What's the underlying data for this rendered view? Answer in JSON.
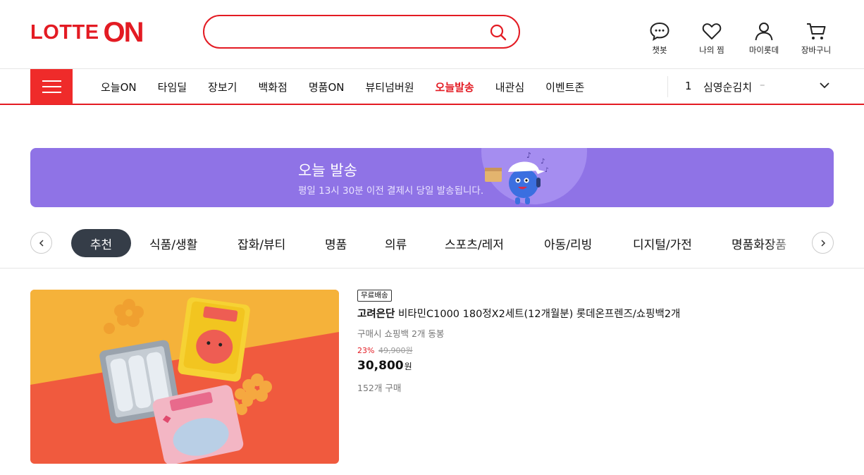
{
  "brand": {
    "logo_lotte": "LOTTE",
    "logo_on": "ON",
    "color": "#e31b23"
  },
  "search": {
    "placeholder": "",
    "value": ""
  },
  "utils": [
    {
      "label": "챗봇",
      "icon": "chat-icon"
    },
    {
      "label": "나의 찜",
      "icon": "heart-icon"
    },
    {
      "label": "마이롯데",
      "icon": "user-icon"
    },
    {
      "label": "장바구니",
      "icon": "cart-icon"
    }
  ],
  "nav": {
    "items": [
      "오늘ON",
      "타임딜",
      "장보기",
      "백화점",
      "명품ON",
      "뷰티넘버원",
      "오늘발송",
      "내관심",
      "이벤트존"
    ],
    "active": "오늘발송"
  },
  "rank": {
    "num": "1",
    "keyword": "심영순김치",
    "change": "–"
  },
  "banner": {
    "title": "오늘 발송",
    "subtitle": "평일 13시 30분 이전 결제시 당일 발송됩니다.",
    "bg": "#8f73e6"
  },
  "categories": {
    "active": "추천",
    "items": [
      "식품/생활",
      "잡화/뷰티",
      "명품",
      "의류",
      "스포츠/레저",
      "아동/리빙",
      "디지털/가전",
      "명품화장품"
    ]
  },
  "product": {
    "tag": "무료배송",
    "brand": "고려은단",
    "name": " 비타민C1000 180정X2세트(12개월분) 롯데온프렌즈/쇼핑백2개",
    "sub": "구매시 쇼핑백 2개 동봉",
    "discount_rate": "23%",
    "original_price": "49,900원",
    "price": "30,800",
    "currency": "원",
    "sold": "152개 구매"
  }
}
